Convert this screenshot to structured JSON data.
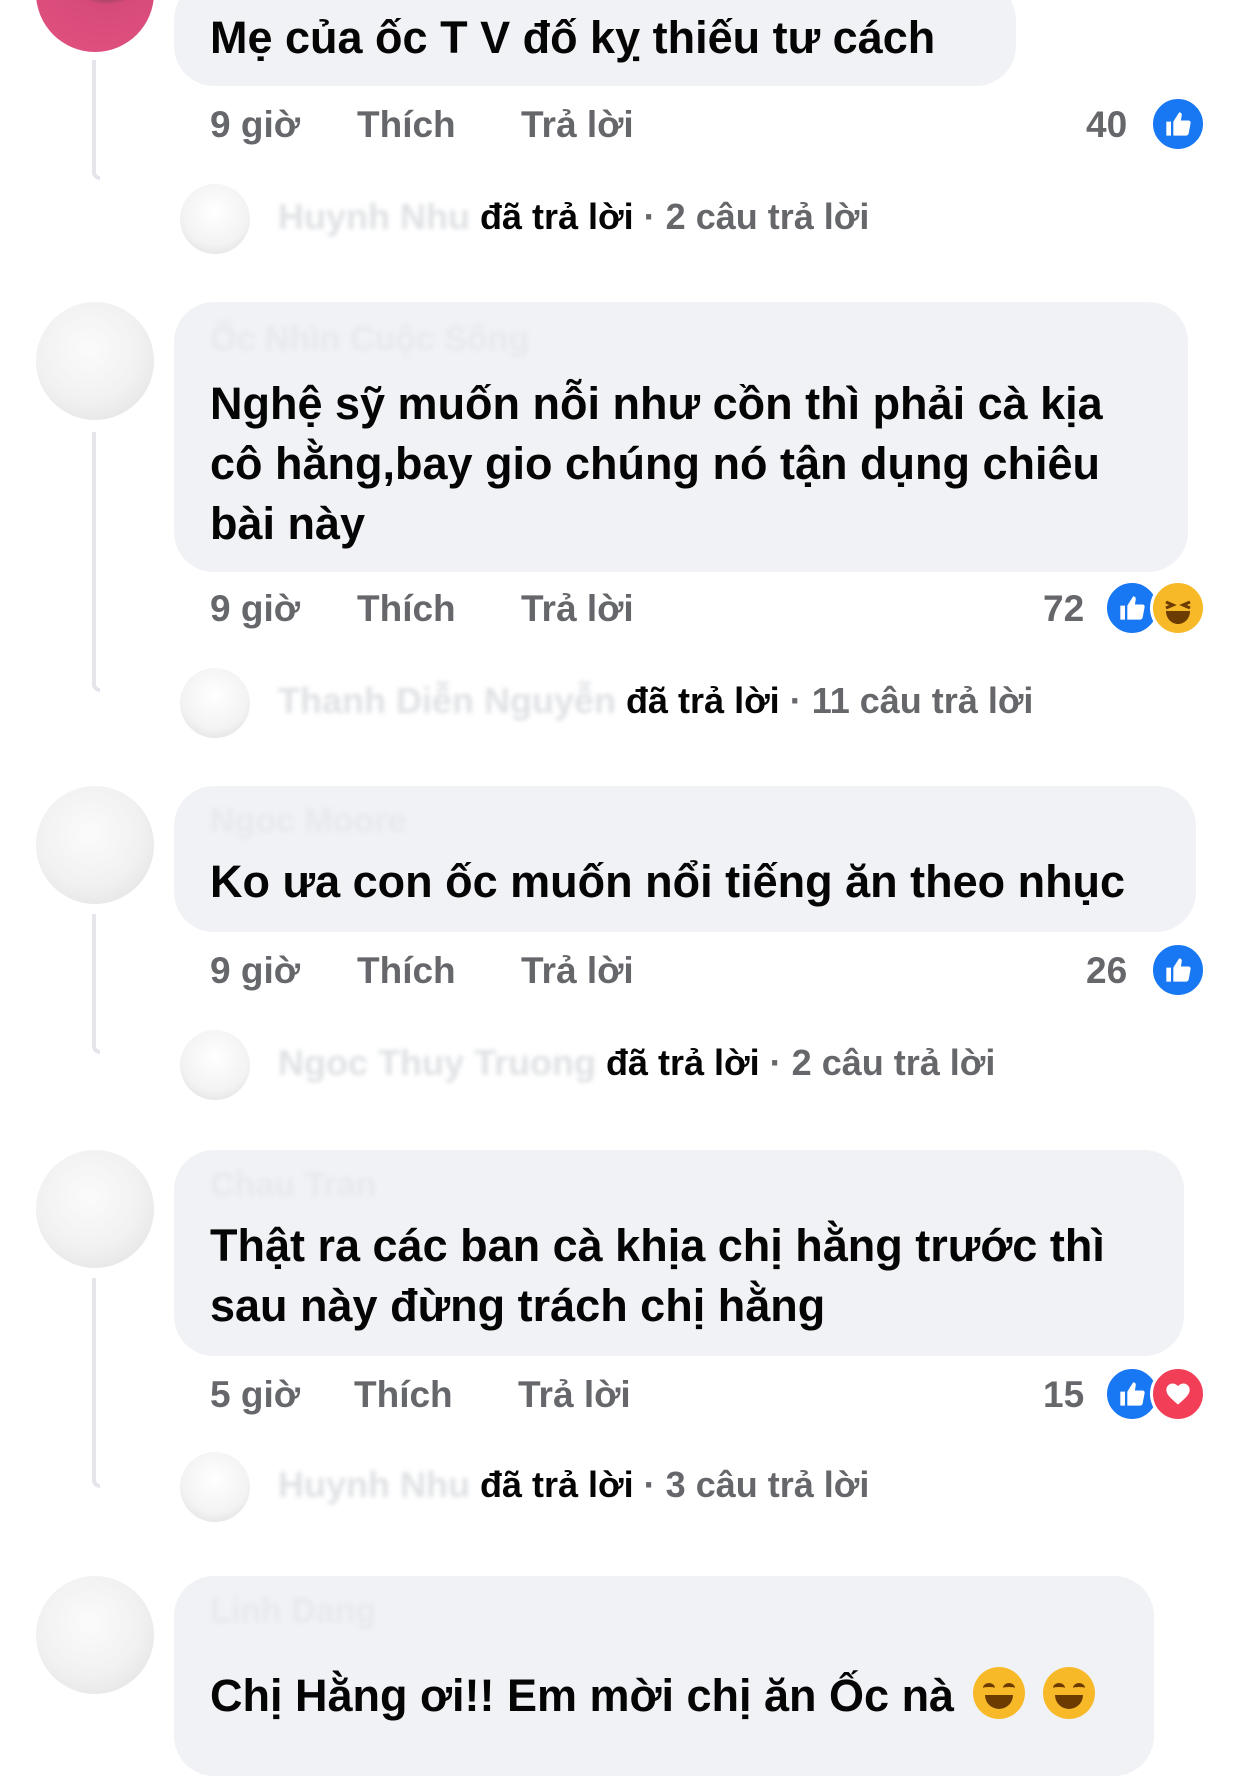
{
  "comments": [
    {
      "author": "",
      "text": "Mẹ của ốc T V đố kỵ thiếu tư cách",
      "time": "9 giờ",
      "like_label": "Thích",
      "reply_label": "Trả lời",
      "reaction_count": "40",
      "reactions": [
        "like-icon"
      ],
      "replies": {
        "name": "Huynh Nhu",
        "action": "đã trả lời",
        "separator": "·",
        "count": "2 câu trả lời"
      }
    },
    {
      "author": "Ốc Nhìn Cuộc Sống",
      "text": "Nghệ sỹ muốn nỗi như cồn thì phải cà kịa cô hằng,bay gio chúng nó tận dụng chiêu bài này",
      "time": "9 giờ",
      "like_label": "Thích",
      "reply_label": "Trả lời",
      "reaction_count": "72",
      "reactions": [
        "like-icon",
        "haha-icon"
      ],
      "replies": {
        "name": "Thanh Diễn Nguyễn",
        "action": "đã trả lời",
        "separator": "·",
        "count": "11 câu trả lời"
      }
    },
    {
      "author": "Ngoc Moore",
      "text": "Ko ưa con ốc muốn nổi tiếng ăn theo nhục",
      "time": "9 giờ",
      "like_label": "Thích",
      "reply_label": "Trả lời",
      "reaction_count": "26",
      "reactions": [
        "like-icon"
      ],
      "replies": {
        "name": "Ngoc Thuy Truong",
        "action": "đã trả lời",
        "separator": "·",
        "count": "2 câu trả lời"
      }
    },
    {
      "author": "Chau Tran",
      "text": "Thật ra các ban cà khịa chị hằng trước thì sau này đừng trách chị hằng",
      "time": "5 giờ",
      "like_label": "Thích",
      "reply_label": "Trả lời",
      "reaction_count": "15",
      "reactions": [
        "like-icon",
        "love-icon"
      ],
      "replies": {
        "name": "Huynh Nhu",
        "action": "đã trả lời",
        "separator": "·",
        "count": "3 câu trả lời"
      }
    },
    {
      "author": "Linh Dang",
      "text": "Chị Hằng ơi!! Em mời chị ăn Ốc nà",
      "emoji": [
        "rofl-emoji",
        "rofl-emoji"
      ]
    }
  ]
}
